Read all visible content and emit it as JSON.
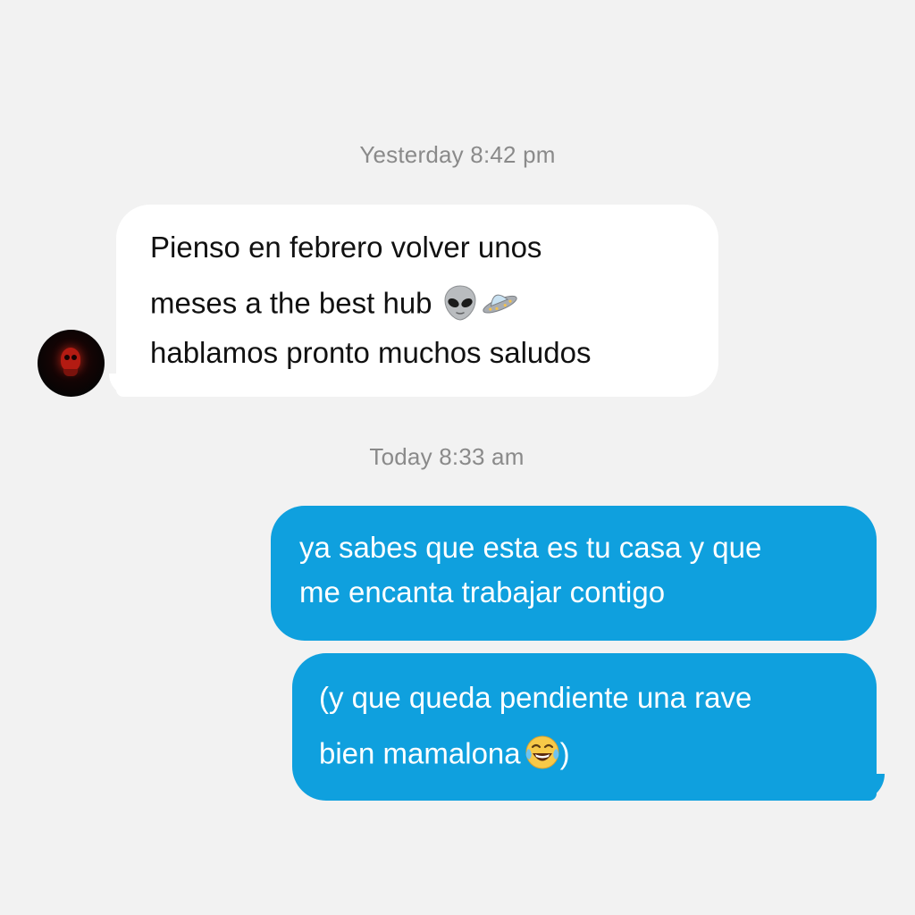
{
  "conversation": {
    "timestamps": [
      {
        "day": "Yesterday",
        "time": "8:42 pm"
      },
      {
        "day": "Today",
        "time": "8:33 am"
      }
    ],
    "incoming": {
      "lines": [
        "Pienso en febrero volver unos",
        "meses a the best hub",
        "hablamos pronto muchos saludos"
      ],
      "icons": [
        "alien-icon",
        "ufo-icon"
      ]
    },
    "outgoing": [
      {
        "lines": [
          "ya sabes que esta es tu casa y que",
          "me encanta trabajar contigo"
        ]
      },
      {
        "lines": [
          "(y que queda pendiente una rave",
          "bien mamalona",
          ")"
        ],
        "icons": [
          "laughing-tears-icon"
        ]
      }
    ]
  },
  "colors": {
    "background": "#f2f2f2",
    "incoming_bubble": "#ffffff",
    "outgoing_bubble": "#0fa0de",
    "timestamp_text": "#8a8a8a"
  }
}
